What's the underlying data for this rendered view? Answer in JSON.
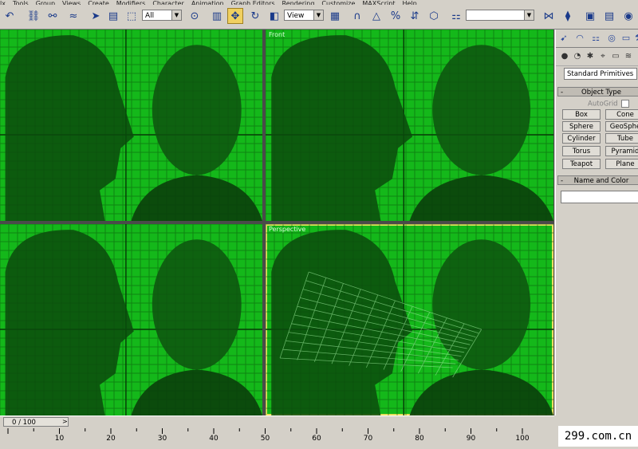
{
  "menu": {
    "items": [
      "lx",
      "Tools",
      "Group",
      "Views",
      "Create",
      "Modifiers",
      "Character",
      "Animation",
      "Graph Editors",
      "Rendering",
      "Customize",
      "MAXScript",
      "Help"
    ]
  },
  "toolbar": {
    "selection_filter": "All",
    "coordinate_system": "View",
    "named_selection": ""
  },
  "viewports": {
    "top_left": {
      "label": ""
    },
    "top_right": {
      "label": "Front"
    },
    "bottom_left": {
      "label": ""
    },
    "bottom_right": {
      "label": "Perspective"
    }
  },
  "command_panel": {
    "category_dropdown": "Standard Primitives",
    "object_type_title": "Object Type",
    "autogrid_label": "AutoGrid",
    "buttons": [
      "Box",
      "Cone",
      "Sphere",
      "GeoSphe",
      "Cylinder",
      "Tube",
      "Torus",
      "Pyramid",
      "Teapot",
      "Plane"
    ],
    "name_color_title": "Name and Color",
    "name_value": ""
  },
  "time_slider": {
    "label": "0 / 100",
    "current": 0,
    "total": 100
  },
  "trackbar": {
    "ticks": [
      "10",
      "20",
      "30",
      "40",
      "50",
      "60",
      "70",
      "80",
      "90",
      "100"
    ]
  },
  "watermark": "299.com.cn",
  "colors": {
    "viewport_bg": "#14b81a",
    "active_border": "#e8e060",
    "grid": "#0a5a0a"
  }
}
